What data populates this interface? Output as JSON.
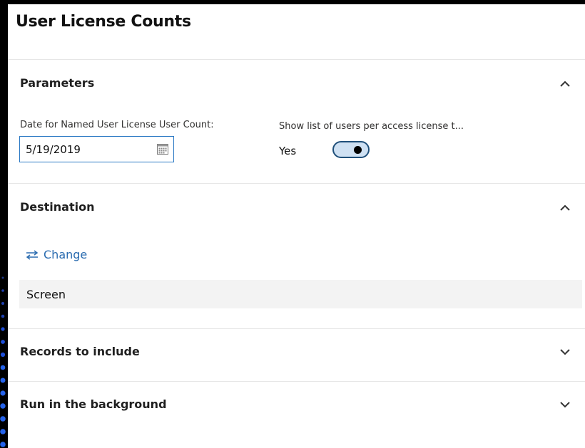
{
  "dialog": {
    "title": "User License Counts"
  },
  "parameters": {
    "heading": "Parameters",
    "date_label": "Date for Named User License User Count:",
    "date_value": "5/19/2019",
    "show_list_label": "Show list of users per access license t...",
    "show_list_value": "Yes",
    "toggle_on": true
  },
  "destination": {
    "heading": "Destination",
    "change_label": "Change",
    "value": "Screen"
  },
  "records": {
    "heading": "Records to include"
  },
  "background": {
    "heading": "Run in the background"
  },
  "icons": {
    "collapse": "chevron-up-icon",
    "expand": "chevron-down-icon",
    "calendar": "calendar-icon",
    "change": "swap-arrows-icon"
  },
  "colors": {
    "accent": "#2b6cb0",
    "toggle_fill": "#cfe1f3",
    "field_border": "#2b79c4"
  }
}
